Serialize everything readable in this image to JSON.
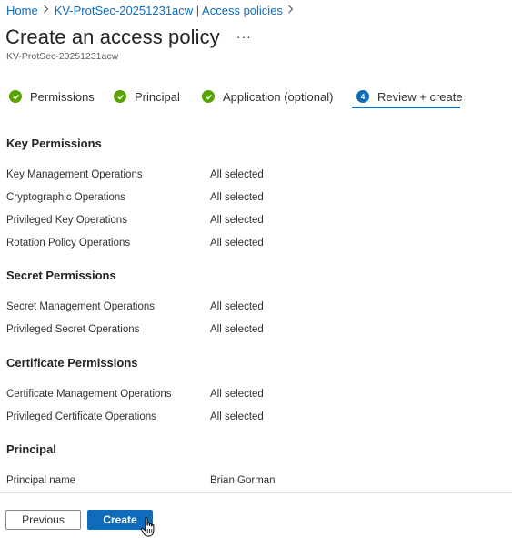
{
  "breadcrumb": {
    "items": [
      "Home",
      "KV-ProtSec-20251231acw | Access policies"
    ]
  },
  "header": {
    "title": "Create an access policy",
    "more_label": "···",
    "subtitle": "KV-ProtSec-20251231acw"
  },
  "wizard": {
    "steps": [
      {
        "label": "Permissions",
        "status": "complete"
      },
      {
        "label": "Principal",
        "status": "complete"
      },
      {
        "label": "Application (optional)",
        "status": "complete"
      },
      {
        "label": "Review + create",
        "status": "active",
        "number": "4"
      }
    ]
  },
  "sections": {
    "key": {
      "title": "Key Permissions",
      "rows": [
        {
          "label": "Key Management Operations",
          "value": "All selected"
        },
        {
          "label": "Cryptographic Operations",
          "value": "All selected"
        },
        {
          "label": "Privileged Key Operations",
          "value": "All selected"
        },
        {
          "label": "Rotation Policy Operations",
          "value": "All selected"
        }
      ]
    },
    "secret": {
      "title": "Secret Permissions",
      "rows": [
        {
          "label": "Secret Management Operations",
          "value": "All selected"
        },
        {
          "label": "Privileged Secret Operations",
          "value": "All selected"
        }
      ]
    },
    "certificate": {
      "title": "Certificate Permissions",
      "rows": [
        {
          "label": "Certificate Management Operations",
          "value": "All selected"
        },
        {
          "label": "Privileged Certificate Operations",
          "value": "All selected"
        }
      ]
    },
    "principal": {
      "title": "Principal",
      "rows": [
        {
          "label": "Principal name",
          "value": "Brian Gorman"
        }
      ]
    }
  },
  "footer": {
    "previous_label": "Previous",
    "create_label": "Create"
  },
  "colors": {
    "accent": "#0f6cbd",
    "success": "#57a300"
  }
}
